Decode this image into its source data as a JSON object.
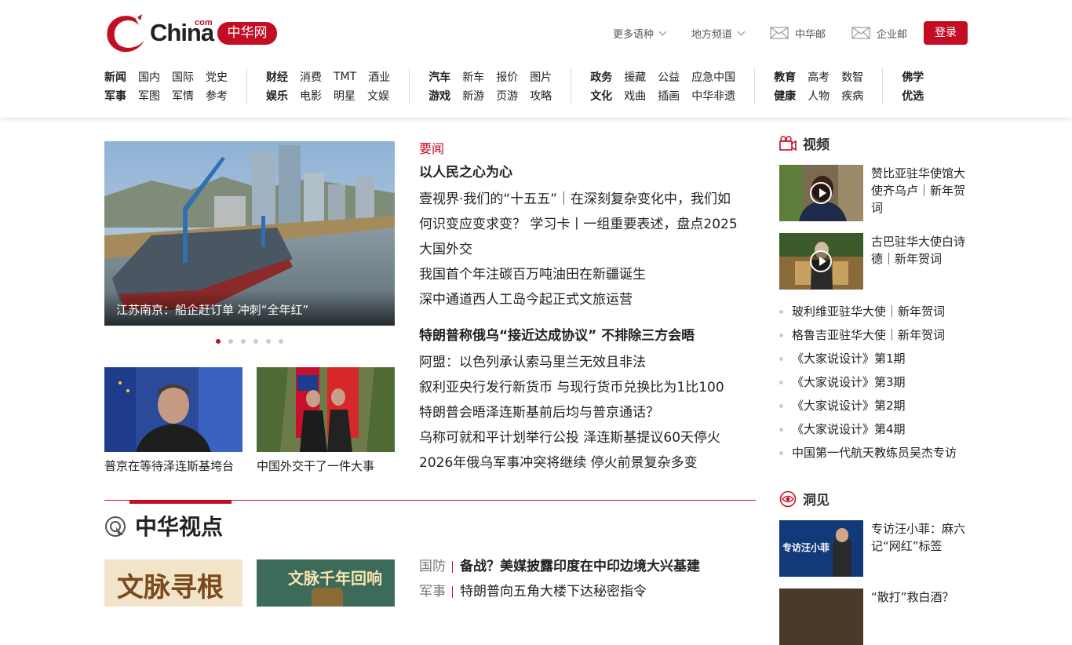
{
  "header": {
    "logo": {
      "brand": "China",
      "com": "com",
      "zh": "中华网"
    },
    "top_links": [
      "更多语种",
      "地方频道"
    ],
    "mail_links": [
      "中华邮",
      "企业邮"
    ],
    "login": "登录"
  },
  "nav": [
    {
      "rows": [
        [
          "新闻",
          "国内",
          "国际",
          "党史"
        ],
        [
          "军事",
          "军图",
          "军情",
          "参考"
        ]
      ]
    },
    {
      "rows": [
        [
          "财经",
          "消费",
          "TMT",
          "酒业"
        ],
        [
          "娱乐",
          "电影",
          "明星",
          "文娱"
        ]
      ]
    },
    {
      "rows": [
        [
          "汽车",
          "新车",
          "报价",
          "图片"
        ],
        [
          "游戏",
          "新游",
          "页游",
          "攻略"
        ]
      ]
    },
    {
      "rows": [
        [
          "政务",
          "援藏",
          "公益",
          "应急中国"
        ],
        [
          "文化",
          "戏曲",
          "插画",
          "中华非遗"
        ]
      ]
    },
    {
      "rows": [
        [
          "教育",
          "高考",
          "数智"
        ],
        [
          "健康",
          "人物",
          "疾病"
        ]
      ]
    },
    {
      "rows": [
        [
          "佛学"
        ],
        [
          "优选"
        ]
      ]
    }
  ],
  "slider": {
    "caption": "江苏南京：船企赶订单 冲刺“全年红”",
    "dots": 6,
    "active": 0
  },
  "thumbs": [
    {
      "title": "普京在等待泽连斯基垮台"
    },
    {
      "title": "中国外交干了一件大事"
    }
  ],
  "news": {
    "label": "要闻",
    "block1": [
      {
        "text": "以人民之心为心",
        "bold": true
      },
      {
        "text": "壹视界·我们的“十五五”｜在深刻复杂变化中，我们如"
      },
      {
        "text": "何识变应变求变？ 学习卡丨一组重要表述，盘点2025"
      },
      {
        "text": "大国外交"
      },
      {
        "text": "我国首个年注碳百万吨油田在新疆诞生"
      },
      {
        "text": "深中通道西人工岛今起正式文旅运营"
      }
    ],
    "block2": [
      {
        "text": "特朗普称俄乌“接近达成协议” 不排除三方会晤",
        "bold": true
      },
      {
        "text": "阿盟：以色列承认索马里兰无效且非法"
      },
      {
        "text": "叙利亚央行发行新货币 与现行货币兑换比为1比100"
      },
      {
        "text": "特朗普会晤泽连斯基前后均与普京通话？"
      },
      {
        "text": "乌称可就和平计划举行公投 泽连斯基提议60天停火"
      },
      {
        "text": "2026年俄乌军事冲突将继续 停火前景复杂多变"
      }
    ]
  },
  "viewpoint": {
    "title": "中华视点",
    "img1_text": "文脉寻根",
    "img2_text": "文脉千年回响",
    "rows": [
      {
        "cat": "国防",
        "text": "备战？美媒披露印度在中印边境大兴基建",
        "bold": true
      },
      {
        "cat": "军事",
        "text": "特朗普向五角大楼下达秘密指令",
        "bold": false
      }
    ]
  },
  "sidebar": {
    "video_title": "视频",
    "videos": [
      {
        "title": "赞比亚驻华使馆大使齐乌卢｜新年贺词"
      },
      {
        "title": "古巴驻华大使白诗德｜新年贺词"
      }
    ],
    "list": [
      "玻利维亚驻华大使｜新年贺词",
      "格鲁吉亚驻华大使｜新年贺词",
      "《大家说设计》第1期",
      "《大家说设计》第3期",
      "《大家说设计》第2期",
      "《大家说设计》第4期",
      "中国第一代航天教练员吴杰专访"
    ],
    "insight_title": "洞见",
    "insights": [
      {
        "title": "专访汪小菲：麻六记“网红”标签",
        "img_text": "专访汪小菲"
      },
      {
        "title": "“散打”救白酒？"
      }
    ]
  },
  "colors": {
    "accent": "#c30d23"
  }
}
